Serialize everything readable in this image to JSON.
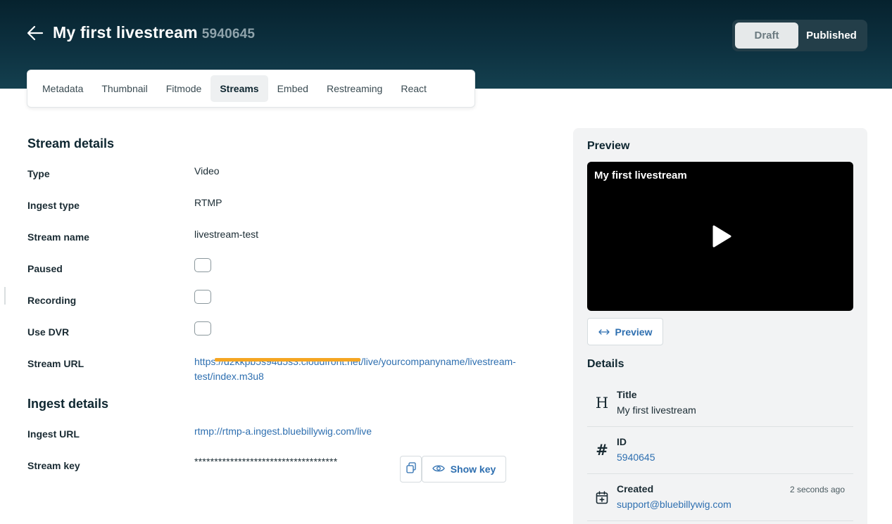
{
  "header": {
    "title": "My first livestream",
    "id": "5940645",
    "status_toggle": {
      "draft": "Draft",
      "published": "Published",
      "selected": "Draft"
    }
  },
  "tabs": [
    {
      "label": "Metadata"
    },
    {
      "label": "Thumbnail"
    },
    {
      "label": "Fitmode"
    },
    {
      "label": "Streams",
      "active": true
    },
    {
      "label": "Embed"
    },
    {
      "label": "Restreaming"
    },
    {
      "label": "React"
    }
  ],
  "stream_details": {
    "title": "Stream details",
    "type_label": "Type",
    "type_value": "Video",
    "ingest_type_label": "Ingest type",
    "ingest_type_value": "RTMP",
    "stream_name_label": "Stream name",
    "stream_name_value": "livestream-test",
    "paused_label": "Paused",
    "recording_label": "Recording",
    "use_dvr_label": "Use DVR",
    "stream_url_label": "Stream URL",
    "stream_url_value": "https://d2kkpb5s94d5s3.cloudfront.net/live/yourcompanyname/livestream-test/index.m3u8"
  },
  "ingest_details": {
    "title": "Ingest details",
    "ingest_url_label": "Ingest URL",
    "ingest_url_value": "rtmp://rtmp-a.ingest.bluebillywig.com/live",
    "stream_key_label": "Stream key",
    "stream_key_value": "************************************",
    "show_key_label": "Show key"
  },
  "preview": {
    "title": "Preview",
    "player_title": "My first livestream",
    "button_label": "Preview"
  },
  "details": {
    "title": "Details",
    "title_label": "Title",
    "title_value": "My first livestream",
    "id_label": "ID",
    "id_value": "5940645",
    "created_label": "Created",
    "created_value": "support@bluebillywig.com",
    "created_time": "2 seconds ago"
  },
  "colors": {
    "header_bg": "#0d3140",
    "link": "#2e6fb0",
    "redaction": "#f5a623"
  }
}
